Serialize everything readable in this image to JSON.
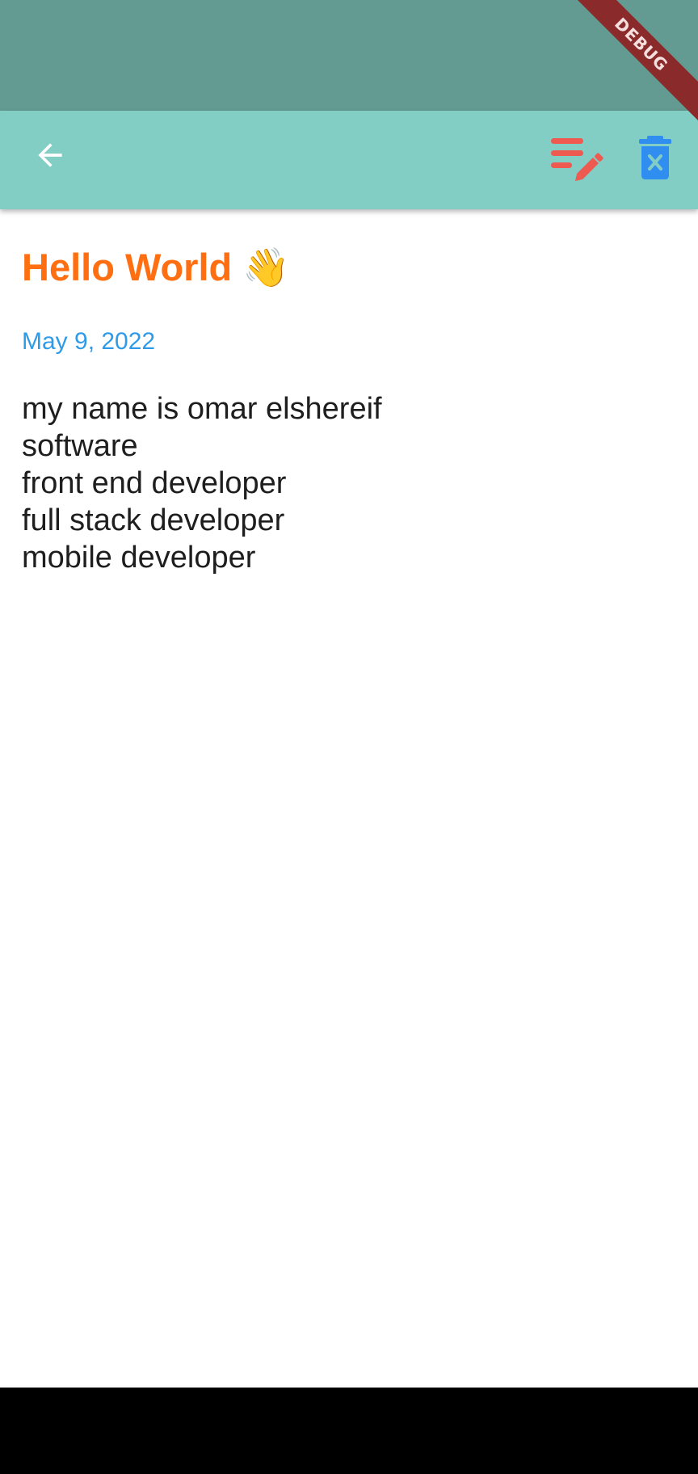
{
  "debug_banner": {
    "label": "DEBUG"
  },
  "app_bar": {
    "back_icon": "arrow-left-icon",
    "edit_icon": "edit-note-icon",
    "delete_icon": "delete-forever-icon",
    "colors": {
      "background": "#82cdc4",
      "edit": "#ee5a4f",
      "delete": "#2f8ef0",
      "back": "#ffffff"
    }
  },
  "note": {
    "title": "Hello World 👋",
    "date": "May 9, 2022",
    "body": "my name is omar elshereif\nsoftware\nfront end developer\nfull stack developer\nmobile developer"
  },
  "colors": {
    "title": "#ff6f12",
    "date": "#2f9be8",
    "status_bar": "#639a92"
  }
}
